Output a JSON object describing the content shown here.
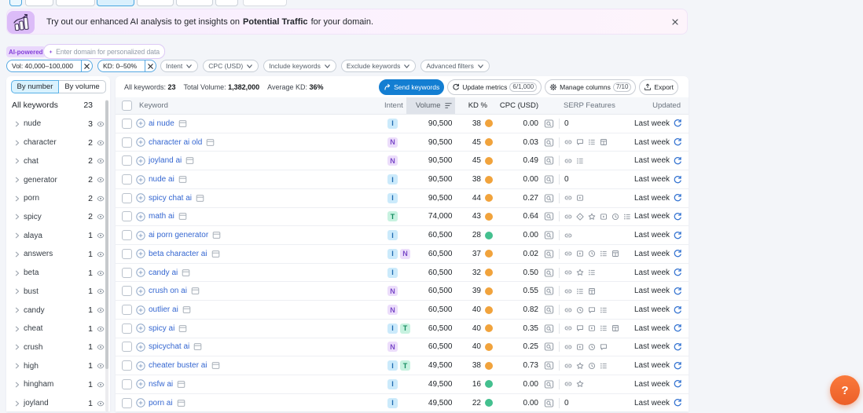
{
  "banner": {
    "text_before": "Try out our enhanced AI analysis to get insights on",
    "text_bold": "Potential Traffic",
    "text_after": "for your domain.",
    "close": "×"
  },
  "ai_bar": {
    "badge": "AI-powered",
    "placeholder": "Enter domain for personalized data"
  },
  "filters": {
    "applied": [
      {
        "label": "Vol: 40,000–100,000",
        "remove": "×"
      },
      {
        "label": "KD: 0–50%",
        "remove": "×"
      }
    ],
    "dropdowns": [
      {
        "label": "Intent"
      },
      {
        "label": "CPC (USD)"
      },
      {
        "label": "Include keywords"
      },
      {
        "label": "Exclude keywords"
      },
      {
        "label": "Advanced filters"
      }
    ]
  },
  "sidebar": {
    "toggle": {
      "by_number": "By number",
      "by_volume": "By volume"
    },
    "header": {
      "label": "All keywords",
      "count": "23"
    },
    "groups": [
      {
        "label": "nude",
        "count": "3"
      },
      {
        "label": "character",
        "count": "2"
      },
      {
        "label": "chat",
        "count": "2"
      },
      {
        "label": "generator",
        "count": "2"
      },
      {
        "label": "porn",
        "count": "2"
      },
      {
        "label": "spicy",
        "count": "2"
      },
      {
        "label": "alaya",
        "count": "1"
      },
      {
        "label": "answers",
        "count": "1"
      },
      {
        "label": "beta",
        "count": "1"
      },
      {
        "label": "bust",
        "count": "1"
      },
      {
        "label": "candy",
        "count": "1"
      },
      {
        "label": "cheat",
        "count": "1"
      },
      {
        "label": "crush",
        "count": "1"
      },
      {
        "label": "high",
        "count": "1"
      },
      {
        "label": "hingham",
        "count": "1"
      },
      {
        "label": "joyland",
        "count": "1"
      }
    ]
  },
  "toolbar": {
    "stats": [
      {
        "label": "All keywords:",
        "value": "23"
      },
      {
        "label": "Total Volume:",
        "value": "1,382,000"
      },
      {
        "label": "Average KD:",
        "value": "36%"
      }
    ],
    "send_label": "Send keywords",
    "update_label": "Update metrics",
    "update_count": "6/1,000",
    "manage_label": "Manage columns",
    "manage_count": "7/10",
    "export_label": "Export"
  },
  "table": {
    "columns": [
      "Keyword",
      "Intent",
      "Volume",
      "KD %",
      "CPC (USD)",
      "SERP Features",
      "Updated"
    ],
    "rows": [
      {
        "keyword": "ai nude",
        "intents": [
          "I"
        ],
        "volume": "90,500",
        "kd": "38",
        "kd_level": "medium",
        "cpc": "0.00",
        "features": [],
        "updated": "Last week"
      },
      {
        "keyword": "character ai old",
        "intents": [
          "N"
        ],
        "volume": "90,500",
        "kd": "45",
        "kd_level": "medium",
        "cpc": "0.03",
        "features": [
          "link",
          "comment",
          "list",
          "table"
        ],
        "updated": "Last week"
      },
      {
        "keyword": "joyland ai",
        "intents": [
          "N"
        ],
        "volume": "90,500",
        "kd": "45",
        "kd_level": "medium",
        "cpc": "0.49",
        "features": [
          "link",
          "list"
        ],
        "updated": "Last week"
      },
      {
        "keyword": "nude ai",
        "intents": [
          "I"
        ],
        "volume": "90,500",
        "kd": "38",
        "kd_level": "medium",
        "cpc": "0.00",
        "features": [],
        "updated": "Last week"
      },
      {
        "keyword": "spicy chat ai",
        "intents": [
          "I"
        ],
        "volume": "90,500",
        "kd": "44",
        "kd_level": "medium",
        "cpc": "0.27",
        "features": [
          "link",
          "video"
        ],
        "updated": "Last week"
      },
      {
        "keyword": "math ai",
        "intents": [
          "T"
        ],
        "volume": "74,000",
        "kd": "43",
        "kd_level": "medium",
        "cpc": "0.64",
        "features": [
          "link",
          "diamond",
          "star",
          "video",
          "clock",
          "list"
        ],
        "updated": "Last week"
      },
      {
        "keyword": "ai porn generator",
        "intents": [
          "I"
        ],
        "volume": "60,500",
        "kd": "28",
        "kd_level": "easy",
        "cpc": "0.00",
        "features": [
          "link"
        ],
        "updated": "Last week"
      },
      {
        "keyword": "beta character ai",
        "intents": [
          "I",
          "N"
        ],
        "volume": "60,500",
        "kd": "37",
        "kd_level": "medium",
        "cpc": "0.02",
        "features": [
          "link",
          "video",
          "clock",
          "list",
          "table"
        ],
        "updated": "Last week"
      },
      {
        "keyword": "candy ai",
        "intents": [
          "I"
        ],
        "volume": "60,500",
        "kd": "32",
        "kd_level": "medium",
        "cpc": "0.50",
        "features": [
          "link",
          "star",
          "list"
        ],
        "updated": "Last week"
      },
      {
        "keyword": "crush on ai",
        "intents": [
          "N"
        ],
        "volume": "60,500",
        "kd": "39",
        "kd_level": "medium",
        "cpc": "0.55",
        "features": [
          "link",
          "list",
          "table"
        ],
        "updated": "Last week"
      },
      {
        "keyword": "outlier ai",
        "intents": [
          "N"
        ],
        "volume": "60,500",
        "kd": "40",
        "kd_level": "medium",
        "cpc": "0.82",
        "features": [
          "link",
          "clock",
          "comment",
          "list"
        ],
        "updated": "Last week"
      },
      {
        "keyword": "spicy ai",
        "intents": [
          "I",
          "T"
        ],
        "volume": "60,500",
        "kd": "40",
        "kd_level": "medium",
        "cpc": "0.35",
        "features": [
          "link",
          "comment",
          "video",
          "list",
          "table"
        ],
        "updated": "Last week"
      },
      {
        "keyword": "spicychat ai",
        "intents": [
          "N"
        ],
        "volume": "60,500",
        "kd": "40",
        "kd_level": "medium",
        "cpc": "0.25",
        "features": [
          "link",
          "video",
          "clock",
          "comment"
        ],
        "updated": "Last week"
      },
      {
        "keyword": "cheater buster ai",
        "intents": [
          "I",
          "T"
        ],
        "volume": "49,500",
        "kd": "38",
        "kd_level": "medium",
        "cpc": "0.73",
        "features": [
          "link",
          "star",
          "clock",
          "list"
        ],
        "updated": "Last week"
      },
      {
        "keyword": "nsfw ai",
        "intents": [
          "I"
        ],
        "volume": "49,500",
        "kd": "16",
        "kd_level": "easy",
        "cpc": "0.00",
        "features": [
          "link",
          "star"
        ],
        "updated": "Last week"
      },
      {
        "keyword": "porn ai",
        "intents": [
          "I"
        ],
        "volume": "49,500",
        "kd": "22",
        "kd_level": "easy",
        "cpc": "0.00",
        "features": [],
        "updated": "Last week"
      }
    ]
  },
  "help": {
    "label": "?"
  }
}
